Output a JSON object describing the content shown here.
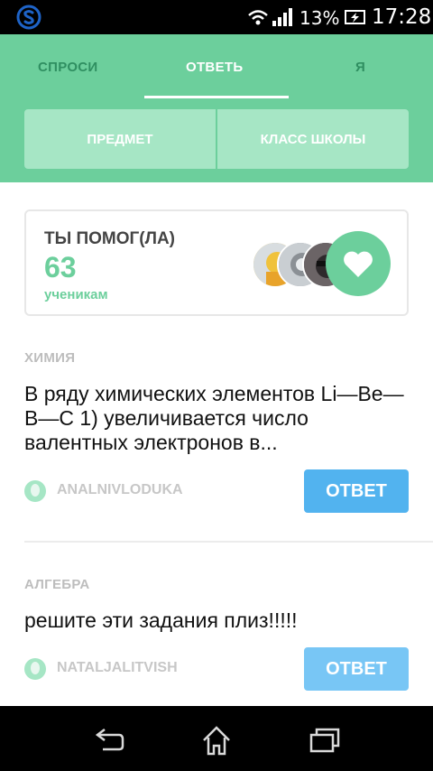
{
  "status_bar": {
    "battery_percent": "13%",
    "time": "17:28",
    "icons": [
      "app-logo-icon",
      "wifi-icon",
      "signal-icon",
      "battery-charging-icon"
    ]
  },
  "tabs": [
    {
      "label": "СПРОСИ",
      "active": false
    },
    {
      "label": "ОТВЕТЬ",
      "active": true
    },
    {
      "label": "Я",
      "active": false
    }
  ],
  "filters": {
    "subject": "ПРЕДМЕТ",
    "school_class": "КЛАСС ШКОЛЫ"
  },
  "helped_card": {
    "title": "ТЫ ПОМОГ(ЛА)",
    "count": "63",
    "unit": "ученикам"
  },
  "questions": [
    {
      "subject": "ХИМИЯ",
      "text": "В ряду химических элементов Li—Be—B—C 1) увеличивается число валентных электронов в...",
      "user": "ANALNIVLODUKA",
      "answer_label": "ОТВЕТ"
    },
    {
      "subject": "АЛГЕБРА",
      "text": "решите эти задания плиз!!!!!",
      "user": "NATALJALITVISH",
      "answer_label": "ОТВЕТ"
    }
  ],
  "colors": {
    "brand_green": "#6ccf9c",
    "light_green": "#a6e6c5",
    "answer_blue": "#52b3ef"
  }
}
